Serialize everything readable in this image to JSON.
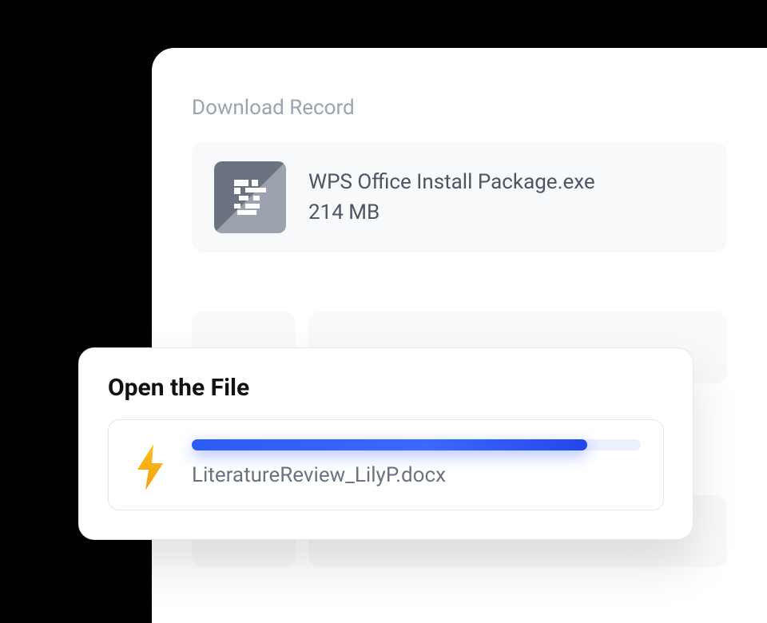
{
  "panel": {
    "title": "Download Record",
    "download": {
      "icon": "wps-app-icon",
      "filename": "WPS Office Install Package.exe",
      "filesize": "214 MB"
    }
  },
  "openFile": {
    "title": "Open the File",
    "icon": "lightning-bolt-icon",
    "filename": "LiteratureReview_LilyP.docx",
    "progress_percent": 88
  }
}
